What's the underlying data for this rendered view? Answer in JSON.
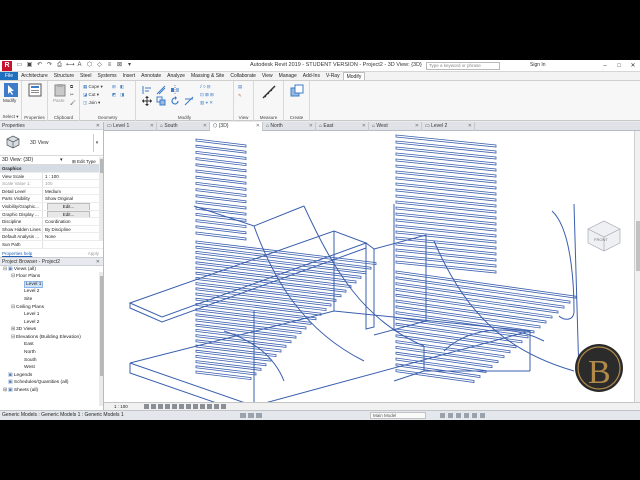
{
  "titlebar": {
    "app_title": "Autodesk Revit 2019 - STUDENT VERSION - Project2 - 3D View: {3D}",
    "search_placeholder": "Type a keyword or phrase",
    "sign_in": "Sign In",
    "logo_letter": "R"
  },
  "menu_tabs": [
    "File",
    "Architecture",
    "Structure",
    "Steel",
    "Systems",
    "Insert",
    "Annotate",
    "Analyze",
    "Massing & Site",
    "Collaborate",
    "View",
    "Manage",
    "Add-Ins",
    "V-Ray",
    "Modify"
  ],
  "ribbon": {
    "select_label": "Select ▾",
    "modify_label": "Modify",
    "properties_label": "Properties",
    "clipboard_label": "Clipboard",
    "geometry_label": "Geometry",
    "modify_panel_label": "Modify",
    "view_label": "View",
    "measure_label": "Measure",
    "create_label": "Create",
    "paste_label": "Paste",
    "cope_label": "Cope",
    "cut_label": "Cut",
    "join_label": "Join"
  },
  "view_tabs": [
    "Level 1",
    "South",
    "{3D}",
    "North",
    "East",
    "West",
    "Level 2"
  ],
  "active_view_tab_index": 2,
  "properties_panel": {
    "header": "Properties",
    "type_name": "3D View",
    "type_selector": "3D View: {3D}",
    "edit_type": "Edit Type",
    "rows": [
      {
        "k": "Graphics",
        "v": "",
        "group": true
      },
      {
        "k": "View Scale",
        "v": "1 : 100"
      },
      {
        "k": "Scale Value  1:",
        "v": "100",
        "dim": true
      },
      {
        "k": "Detail Level",
        "v": "Medium"
      },
      {
        "k": "Parts Visibility",
        "v": "Show Original"
      },
      {
        "k": "Visibility/Graphic...",
        "v": "Edit...",
        "btn": true
      },
      {
        "k": "Graphic Display ...",
        "v": "Edit...",
        "btn": true
      },
      {
        "k": "Discipline",
        "v": "Coordination"
      },
      {
        "k": "Show Hidden Lines",
        "v": "By Discipline"
      },
      {
        "k": "Default Analysis ...",
        "v": "None"
      },
      {
        "k": "Sun Path",
        "v": ""
      }
    ],
    "help_link": "Properties help",
    "apply": "Apply"
  },
  "project_browser": {
    "header": "Project Browser - Project2",
    "nodes": [
      {
        "t": "Views (all)",
        "d": 0,
        "tw": "⊟",
        "icon": true
      },
      {
        "t": "Floor Plans",
        "d": 1,
        "tw": "⊟"
      },
      {
        "t": "Level 1",
        "d": 2,
        "tw": "",
        "sel": true
      },
      {
        "t": "Level 2",
        "d": 2,
        "tw": ""
      },
      {
        "t": "Site",
        "d": 2,
        "tw": ""
      },
      {
        "t": "Ceiling Plans",
        "d": 1,
        "tw": "⊟"
      },
      {
        "t": "Level 1",
        "d": 2,
        "tw": ""
      },
      {
        "t": "Level 2",
        "d": 2,
        "tw": ""
      },
      {
        "t": "3D Views",
        "d": 1,
        "tw": "⊞"
      },
      {
        "t": "Elevations (Building Elevation)",
        "d": 1,
        "tw": "⊟"
      },
      {
        "t": "East",
        "d": 2,
        "tw": ""
      },
      {
        "t": "North",
        "d": 2,
        "tw": ""
      },
      {
        "t": "South",
        "d": 2,
        "tw": ""
      },
      {
        "t": "West",
        "d": 2,
        "tw": ""
      },
      {
        "t": "Legends",
        "d": 0,
        "tw": "",
        "icon": true
      },
      {
        "t": "Schedules/Quantities (all)",
        "d": 0,
        "tw": "",
        "icon": true
      },
      {
        "t": "Sheets (all)",
        "d": 0,
        "tw": "⊞",
        "icon": true
      }
    ]
  },
  "view_control": {
    "scale": "1 : 100"
  },
  "status_bar": {
    "message": "Generic Models : Generic Models 1 : Generic Models 1",
    "model": "Main Model"
  },
  "colors": {
    "file_tab": "#1f6fbf",
    "model_lines": "#3a5fae",
    "logo": "#c8102e"
  }
}
